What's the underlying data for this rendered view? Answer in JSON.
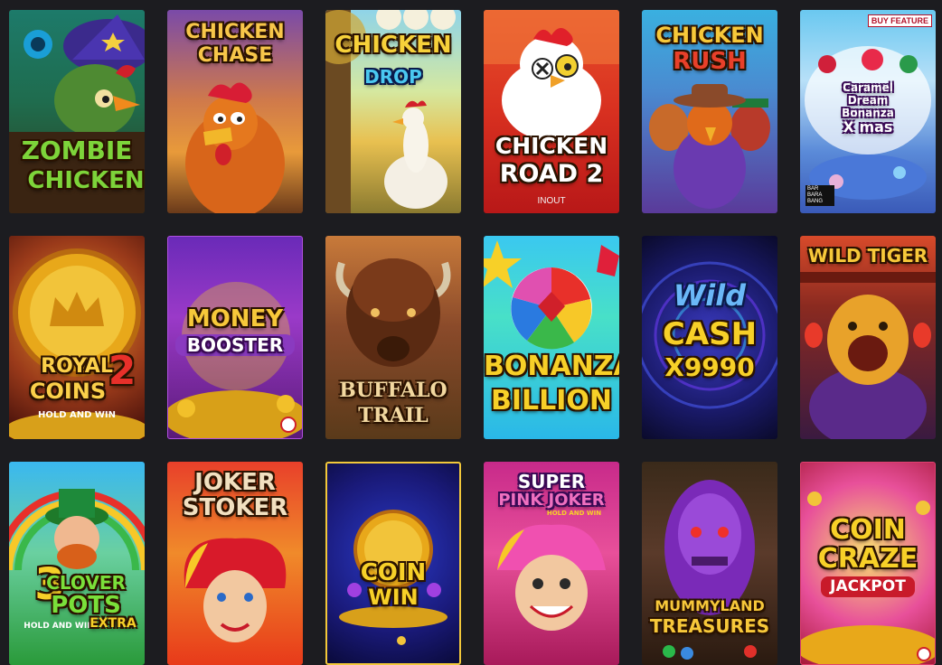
{
  "games": [
    {
      "title_lines": [
        "ZOMBIE",
        "CHICKEN"
      ],
      "name": "zombie-chicken"
    },
    {
      "title_lines": [
        "CHICKEN",
        "CHASE"
      ],
      "name": "chicken-chase"
    },
    {
      "title_lines": [
        "CHICKEN",
        "DROP"
      ],
      "name": "chicken-drop"
    },
    {
      "title_lines": [
        "CHICKEN",
        "ROAD 2"
      ],
      "provider": "INOUT",
      "name": "chicken-road-2"
    },
    {
      "title_lines": [
        "CHICKEN",
        "RUSH"
      ],
      "name": "chicken-rush"
    },
    {
      "title_lines": [
        "Caramel",
        "Dream",
        "Bonanza",
        "X mas"
      ],
      "badge": "BUY FEATURE",
      "provider_lines": [
        "BAR",
        "BARA",
        "BANG"
      ],
      "name": "caramel-dream-bonanza-xmas"
    },
    {
      "title_lines": [
        "ROYAL",
        "COINS",
        "2"
      ],
      "subtitle": "HOLD AND WIN",
      "name": "royal-coins-2"
    },
    {
      "title_lines": [
        "MONEY",
        "BOOSTER"
      ],
      "name": "money-booster"
    },
    {
      "title_lines": [
        "BUFFALO",
        "TRAIL"
      ],
      "name": "buffalo-trail"
    },
    {
      "title_lines": [
        "BONANZA",
        "BILLION"
      ],
      "name": "bonanza-billion"
    },
    {
      "title_lines": [
        "Wild",
        "CASH",
        "X9990"
      ],
      "name": "wild-cash-x9990"
    },
    {
      "title_lines": [
        "WILD TIGER"
      ],
      "name": "wild-tiger"
    },
    {
      "title_lines": [
        "3",
        "CLOVER",
        "POTS"
      ],
      "subtitle": "HOLD AND WIN",
      "extra": "EXTRA",
      "name": "3-clover-pots-extra"
    },
    {
      "title_lines": [
        "JOKER",
        "STOKER"
      ],
      "name": "joker-stoker"
    },
    {
      "title_lines": [
        "COIN",
        "WIN"
      ],
      "name": "coin-win"
    },
    {
      "title_lines": [
        "SUPER",
        "PINK JOKER"
      ],
      "subtitle": "HOLD AND WIN",
      "name": "super-pink-joker"
    },
    {
      "title_lines": [
        "MUMMYLAND",
        "TREASURES"
      ],
      "name": "mummyland-treasures"
    },
    {
      "title_lines": [
        "COIN",
        "CRAZE",
        "JACKPOT"
      ],
      "name": "coin-craze-jackpot"
    }
  ]
}
